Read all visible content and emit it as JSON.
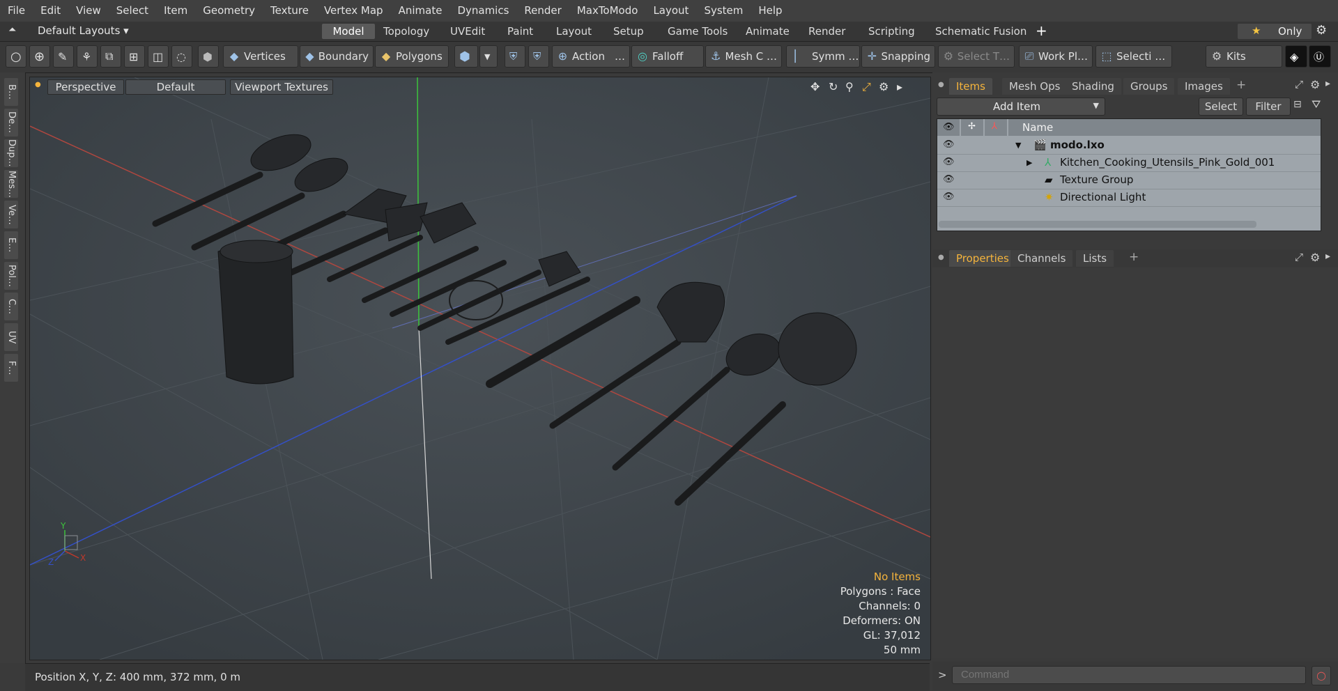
{
  "menu": [
    "File",
    "Edit",
    "View",
    "Select",
    "Item",
    "Geometry",
    "Texture",
    "Vertex Map",
    "Animate",
    "Dynamics",
    "Render",
    "MaxToModo",
    "Layout",
    "System",
    "Help"
  ],
  "layout": {
    "default_layouts": "Default Layouts ▾",
    "tabs": [
      "Model",
      "Topology",
      "UVEdit",
      "Paint",
      "Layout",
      "Setup",
      "Game Tools",
      "Animate",
      "Render",
      "Scripting",
      "Schematic Fusion"
    ],
    "add": "+",
    "only": "Only",
    "star": "★"
  },
  "toolbar": {
    "vertices": "Vertices",
    "boundary": "Boundary",
    "polygons": "Polygons",
    "action": "Action",
    "action_more": "…",
    "falloff": "Falloff",
    "meshc": "Mesh C …",
    "symm": "Symm …",
    "snapping": "Snapping",
    "selectt": "Select T…",
    "workpl": "Work Pl…",
    "selecti": "Selecti …",
    "kits": "Kits"
  },
  "lefttabs": [
    "B…",
    "De…",
    "Dup…",
    "Mes…",
    "Ve…",
    "E…",
    "Pol…",
    "C…",
    "UV",
    "F…"
  ],
  "viewport": {
    "perspective": "Perspective",
    "default": "Default",
    "textures": "Viewport Textures",
    "stats": {
      "no_items": "No Items",
      "polygons": "Polygons : Face",
      "channels": "Channels: 0",
      "deformers": "Deformers: ON",
      "gl": "GL: 37,012",
      "scale": "50 mm"
    },
    "axis": {
      "x": "X",
      "y": "Y",
      "z": "Z"
    }
  },
  "status": {
    "position": "Position X, Y, Z:   400 mm, 372 mm, 0 m"
  },
  "items_panel": {
    "tabs": [
      "Items",
      "Mesh Ops",
      "Shading",
      "Groups",
      "Images"
    ],
    "add": "+",
    "add_item": "Add Item",
    "select": "Select",
    "filter": "Filter",
    "col_name": "Name",
    "rows": [
      "modo.lxo",
      "Kitchen_Cooking_Utensils_Pink_Gold_001",
      "Texture Group",
      "Directional Light"
    ]
  },
  "props_panel": {
    "tabs": [
      "Properties",
      "Channels",
      "Lists"
    ],
    "add": "+"
  },
  "command": {
    "placeholder": "Command",
    "prompt": ">"
  },
  "colors": {
    "accent": "#f5b43c",
    "viewport": "#3f454b",
    "x_axis": "#c0392b",
    "y_axis": "#2ecc40",
    "z_axis": "#2f4fd0"
  }
}
